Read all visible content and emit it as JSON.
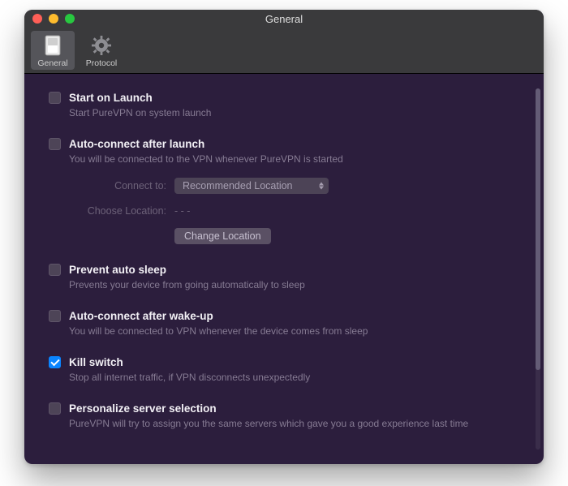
{
  "window": {
    "title": "General"
  },
  "toolbar": {
    "items": [
      {
        "label": "General",
        "icon": "switch-icon",
        "selected": true
      },
      {
        "label": "Protocol",
        "icon": "gear-icon",
        "selected": false
      }
    ]
  },
  "settings": {
    "start_on_launch": {
      "title": "Start on Launch",
      "desc": "Start PureVPN on system launch",
      "checked": false
    },
    "auto_connect_launch": {
      "title": "Auto-connect after launch",
      "desc": "You will be connected to the VPN whenever PureVPN is started",
      "checked": false,
      "connect_to_label": "Connect to:",
      "connect_to_value": "Recommended Location",
      "choose_location_label": "Choose Location:",
      "choose_location_value": "- - -",
      "change_location_btn": "Change Location"
    },
    "prevent_sleep": {
      "title": "Prevent auto sleep",
      "desc": "Prevents your device from going automatically to sleep",
      "checked": false
    },
    "auto_connect_wake": {
      "title": "Auto-connect after wake-up",
      "desc": "You will be connected to VPN whenever the device comes from sleep",
      "checked": false
    },
    "kill_switch": {
      "title": "Kill switch",
      "desc": "Stop all internet traffic, if VPN disconnects unexpectedly",
      "checked": true
    },
    "personalize": {
      "title": "Personalize server selection",
      "desc": "PureVPN will try to assign you the same servers which gave you a good experience last time",
      "checked": false
    }
  }
}
